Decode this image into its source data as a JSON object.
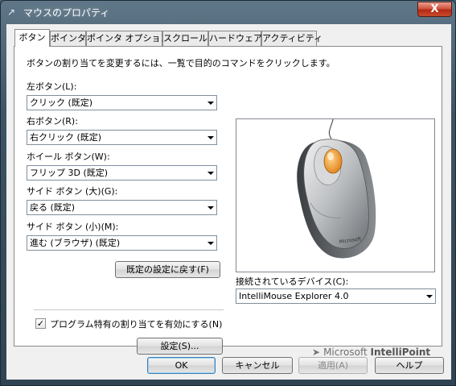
{
  "window": {
    "title": "マウスのプロパティ",
    "close_glyph": "X",
    "title_icon": "mouse-pointer-icon"
  },
  "tabs": [
    {
      "label": "ボタン",
      "active": true
    },
    {
      "label": "ポインタ",
      "active": false
    },
    {
      "label": "ポインタ オプション",
      "active": false
    },
    {
      "label": "スクロール",
      "active": false
    },
    {
      "label": "ハードウェア",
      "active": false
    },
    {
      "label": "アクティビティ",
      "active": false
    }
  ],
  "panel": {
    "description": "ボタンの割り当てを変更するには、一覧で目的のコマンドをクリックします。",
    "left_button": {
      "label": "左ボタン(L):",
      "value": "クリック (既定)"
    },
    "right_button": {
      "label": "右ボタン(R):",
      "value": "右クリック (既定)"
    },
    "wheel_button": {
      "label": "ホイール ボタン(W):",
      "value": "フリップ 3D (既定)"
    },
    "side_large": {
      "label": "サイド ボタン (大)(G):",
      "value": "戻る (既定)"
    },
    "side_small": {
      "label": "サイド ボタン (小)(M):",
      "value": "進む (ブラウザ) (既定)"
    },
    "restore_defaults": "既定の設定に戻す(F)",
    "program_specific": {
      "label": "プログラム特有の割り当てを有効にする(N)",
      "checked": true
    },
    "settings_button": "設定(S)...",
    "device": {
      "label": "接続されているデバイス(C):",
      "value": "IntelliMouse Explorer 4.0"
    },
    "brand": {
      "prefix": "Microsoft",
      "product": "IntelliPoint"
    },
    "mouse_logo_text": "Microsoft"
  },
  "footer": {
    "ok": "OK",
    "cancel": "キャンセル",
    "apply": "適用(A)",
    "help": "ヘルプ"
  },
  "colors": {
    "accent": "#3c7fb1",
    "wheel": "#f0a020"
  }
}
